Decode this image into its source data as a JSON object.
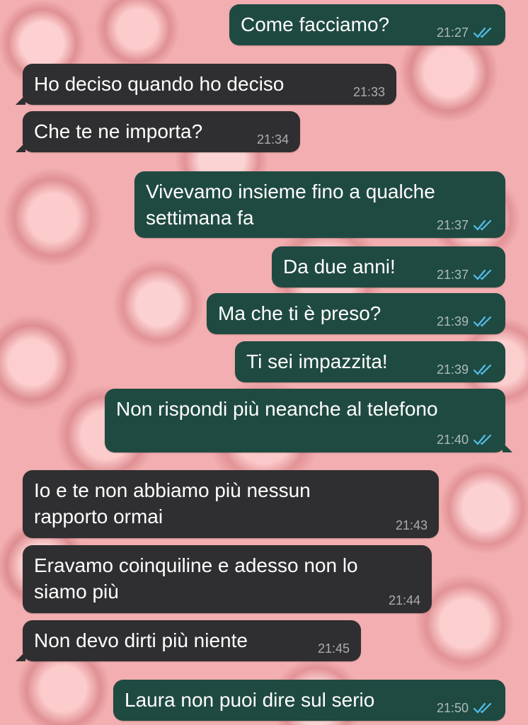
{
  "chat": {
    "messages": [
      {
        "direction": "out",
        "text": "Come facciamo?",
        "time": "21:27",
        "read_icon": "double-check-blue"
      },
      {
        "direction": "in",
        "text": "Ho deciso quando ho deciso",
        "time": "21:33"
      },
      {
        "direction": "in",
        "text": "Che te ne importa?",
        "time": "21:34"
      },
      {
        "direction": "out",
        "text": "Vivevamo insieme fino a qualche\nsettimana fa",
        "time": "21:37",
        "read_icon": "double-check-blue"
      },
      {
        "direction": "out",
        "text": "Da due anni!",
        "time": "21:37",
        "read_icon": "double-check-blue"
      },
      {
        "direction": "out",
        "text": "Ma che ti è preso?",
        "time": "21:39",
        "read_icon": "double-check-blue"
      },
      {
        "direction": "out",
        "text": "Ti sei impazzita!",
        "time": "21:39",
        "read_icon": "double-check-blue"
      },
      {
        "direction": "out",
        "text": "Non rispondi più neanche al telefono",
        "time": "21:40",
        "read_icon": "double-check-blue"
      },
      {
        "direction": "in",
        "text": "Io e te non abbiamo più nessun\nrapporto ormai",
        "time": "21:43"
      },
      {
        "direction": "in",
        "text": "Eravamo coinquiline e adesso non lo\nsiamo più",
        "time": "21:44"
      },
      {
        "direction": "in",
        "text": "Non devo dirti più niente",
        "time": "21:45"
      },
      {
        "direction": "out",
        "text": "Laura non puoi dire sul serio",
        "time": "21:50",
        "read_icon": "double-check-blue"
      }
    ]
  },
  "colors": {
    "outgoing_bubble": "#1f4a41",
    "incoming_bubble": "#2f2f31",
    "read_ticks": "#53bdeb",
    "wallpaper": "#f2aeb0"
  }
}
